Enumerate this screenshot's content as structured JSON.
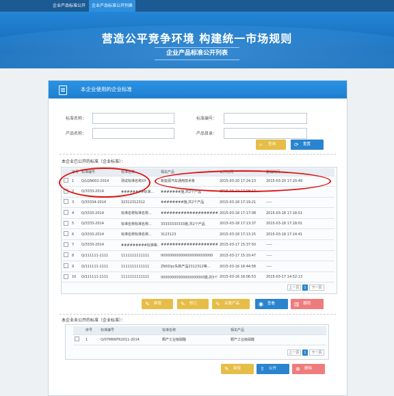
{
  "topnav": {
    "tabs": [
      "企业产品标准公开",
      "企业产品标准公开列表"
    ]
  },
  "banner": {
    "title": "营造公平竞争环境 构建统一市场规则",
    "subtitle": "企业产品标准公开列表"
  },
  "panel": {
    "title": "本企业使用的企业标准"
  },
  "search": {
    "std_name_label": "标准名称：",
    "std_code_label": "标准编号：",
    "product_name_label": "产品名称：",
    "product_category_label": "产品目录：",
    "std_name_value": "",
    "std_code_value": "",
    "product_name_value": "",
    "product_category_value": "",
    "query_label": "查询",
    "reset_label": "重置"
  },
  "public_section": {
    "title": "本企业已公开的标准（企业标准）：",
    "headers": [
      "序号",
      "标准编号",
      "标准名称",
      "相关产品",
      "公开时间",
      "撤销时间"
    ],
    "rows": [
      [
        "1",
        "Q/LQN002-2014",
        "测试标准名称XX",
        "新能源汽车通用技术条",
        "2015-03-20 17:24:13",
        "2015-03-20 17:20:49"
      ],
      [
        "2",
        "Q/3333-2014",
        "########标准...",
        "#######施,共2个产品",
        "2015-03-19 17:08:17",
        "-----"
      ],
      [
        "3",
        "Q/33334-2014",
        "32312312312",
        "########施,共2个产品",
        "2015-03-18 17:19:21",
        "-----"
      ],
      [
        "4",
        "Q/3333-2014",
        "标准名称标准名称...",
        "######################等,共3个产品",
        "2015-03-18 17:17:08",
        "2015-03-18 17:18:51"
      ],
      [
        "5",
        "Q/3333-2014",
        "标准名称标准名称...",
        "33333333333施,共2个产品",
        "2015-03-18 17:13:37",
        "2015-03-18 17:18:01"
      ],
      [
        "6",
        "Q/3333-2014",
        "标准名称标准名称...",
        "3123123",
        "2015-03-18 17:13:15",
        "2015-03-18 17:14:41"
      ],
      [
        "7",
        "Q/3333-2014",
        "#########标准等...",
        "################################",
        "2015-03-17 15:37:50",
        "-----"
      ],
      [
        "8",
        "Q/111111-1111",
        "1111111111111",
        "000000000000000000000000",
        "2015-03-17 15:10:47",
        "-----"
      ],
      [
        "9",
        "Q/111111-1111",
        "1111111111111",
        "ZNXDpc失新产品2312312等...",
        "2015-03-16 16:44:58",
        "-----"
      ],
      [
        "10",
        "Q/111111-1111",
        "1111111111111",
        "00000000000000000000施,共5个",
        "2015-03-16 16:06:53",
        "2015-03-17 14:52:13"
      ]
    ],
    "pager": {
      "prev": "上一页",
      "current": "1",
      "next": "下一页"
    },
    "buttons": {
      "new": "新增",
      "edit": "修订",
      "related": "关联产品",
      "view": "查看",
      "revoke": "撤销"
    }
  },
  "nonpublic_section": {
    "title": "本企业未公开的标准（企业标准）：",
    "headers": [
      "序号",
      "标准编号",
      "标准名称",
      "相关产品"
    ],
    "rows": [
      [
        "1",
        "Q/07MRRFR2011-2014",
        "颗产工业级硝酸",
        "颗产工业级硝酸"
      ]
    ],
    "pager": {
      "prev": "上一页",
      "current": "1",
      "next": "下一页"
    },
    "buttons": {
      "new": "新增",
      "publish": "公开",
      "delete": "删除"
    }
  },
  "colors": {
    "nav": "#1b5a92",
    "banner": "#1569b8",
    "accent_blue": "#2a84cf",
    "button_yellow": "#e6bd47",
    "button_red": "#ef7c7c",
    "annotation_red": "#dd1010"
  }
}
